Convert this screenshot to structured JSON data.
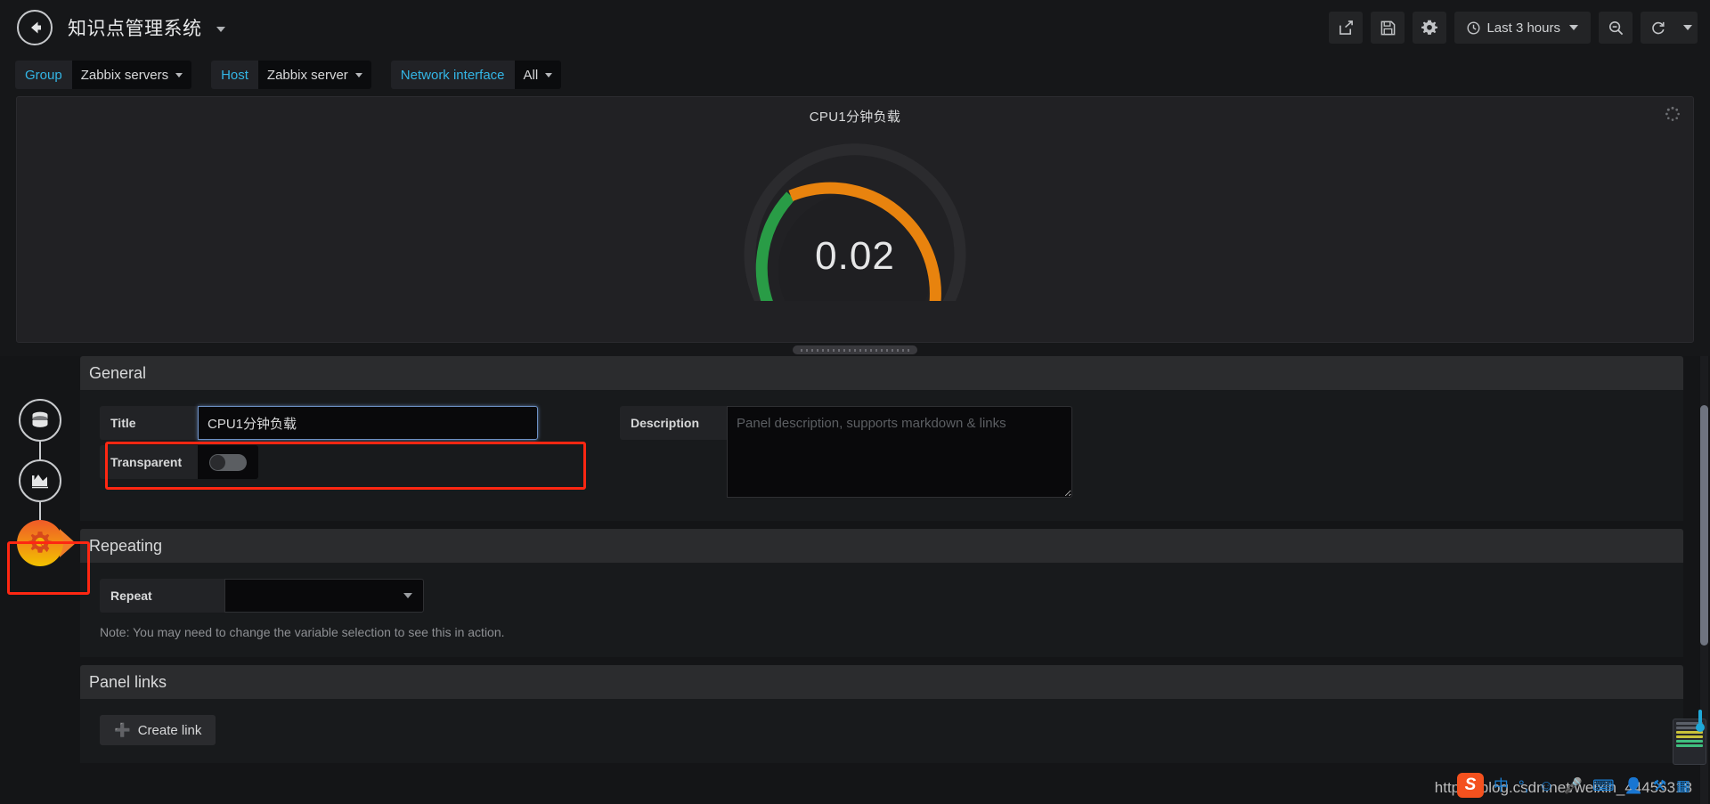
{
  "navbar": {
    "back_icon": "arrow-left-icon",
    "dashboard_title": "知识点管理系统",
    "actions": [
      {
        "name": "share-dashboard-button",
        "icon": "share-icon"
      },
      {
        "name": "save-dashboard-button",
        "icon": "save-floppy-icon"
      },
      {
        "name": "dashboard-settings-button",
        "icon": "gear-icon"
      }
    ],
    "time_picker": {
      "icon": "clock-icon",
      "label": "Last 3 hours"
    },
    "zoom_out": {
      "name": "zoom-out-button",
      "icon": "search-minus-icon"
    },
    "refresh": {
      "name": "refresh-button",
      "icon": "refresh-icon"
    }
  },
  "variables": [
    {
      "label": "Group",
      "value": "Zabbix servers"
    },
    {
      "label": "Host",
      "value": "Zabbix server"
    },
    {
      "label": "Network interface",
      "value": "All"
    }
  ],
  "panel": {
    "title": "CPU1分钟负载",
    "spinner_icon": "loading-spinner-icon",
    "resize_handle": "panel-resize-handle"
  },
  "chart_data": {
    "type": "gauge",
    "title": "CPU1分钟负载",
    "value": 0.02,
    "display_value": "0.02",
    "min": 0,
    "max": 100,
    "unit": "",
    "thresholds": [
      {
        "from": 0,
        "to": 20,
        "color": "#299c46",
        "name": "green"
      },
      {
        "from": 20,
        "to": 100,
        "color": "#e8830e",
        "name": "orange"
      }
    ],
    "start_angle": -135,
    "end_angle": 135,
    "needle_color": "#299c46"
  },
  "editor": {
    "active_tab": "general",
    "tabs": [
      {
        "name": "queries-tab",
        "icon": "database-icon",
        "active": false
      },
      {
        "name": "visualization-tab",
        "icon": "graph-area-icon",
        "active": false
      },
      {
        "name": "general-tab",
        "icon": "gear-wrench-icon",
        "active": true
      }
    ],
    "general": {
      "section_title": "General",
      "title_label": "Title",
      "title_value": "CPU1分钟负载",
      "transparent_label": "Transparent",
      "transparent_on": false,
      "description_label": "Description",
      "description_value": "",
      "description_placeholder": "Panel description, supports markdown & links"
    },
    "repeating": {
      "section_title": "Repeating",
      "repeat_label": "Repeat",
      "repeat_value": "",
      "note": "Note: You may need to change the variable selection to see this in action."
    },
    "panel_links": {
      "section_title": "Panel links",
      "create_link_label": "Create link",
      "create_link_icon": "plus-icon"
    }
  },
  "ime": {
    "logo": "S",
    "icons": [
      "chinese-mode-icon",
      "punctuation-icon",
      "emoji-icon",
      "microphone-icon",
      "keyboard-icon",
      "user-icon",
      "toolbox-icon",
      "panel-icon"
    ]
  },
  "watermark": {
    "text": "https://blog.csdn.net/weixin_44455318"
  },
  "colors": {
    "accent_blue": "#33b5e5",
    "gauge_green": "#299c46",
    "gauge_orange": "#e8830e",
    "annotation_red": "#fe2712",
    "panel_bg": "#212124",
    "page_bg": "#161719"
  }
}
